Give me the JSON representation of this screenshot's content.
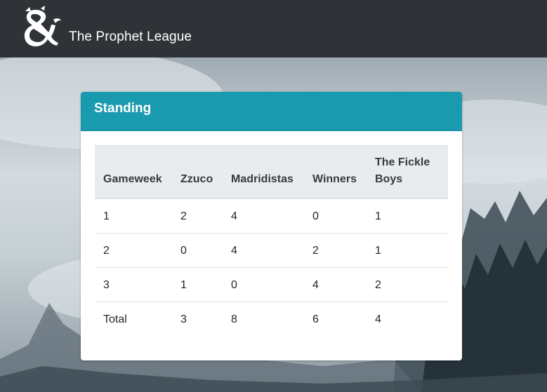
{
  "brand": {
    "name": "The Prophet League",
    "logo_icon": "ampersand-dragon-logo"
  },
  "card": {
    "title": "Standing",
    "header_color": "#1a9aae"
  },
  "standings": {
    "columns": [
      "Gameweek",
      "Zzuco",
      "Madridistas",
      "Winners",
      "The Fickle Boys"
    ],
    "rows": [
      [
        "1",
        "2",
        "4",
        "0",
        "1"
      ],
      [
        "2",
        "0",
        "4",
        "2",
        "1"
      ],
      [
        "3",
        "1",
        "0",
        "4",
        "2"
      ],
      [
        "Total",
        "3",
        "8",
        "6",
        "4"
      ]
    ]
  },
  "colors": {
    "navbar": "#2f3338",
    "table_header_bg": "#e9ecef"
  }
}
